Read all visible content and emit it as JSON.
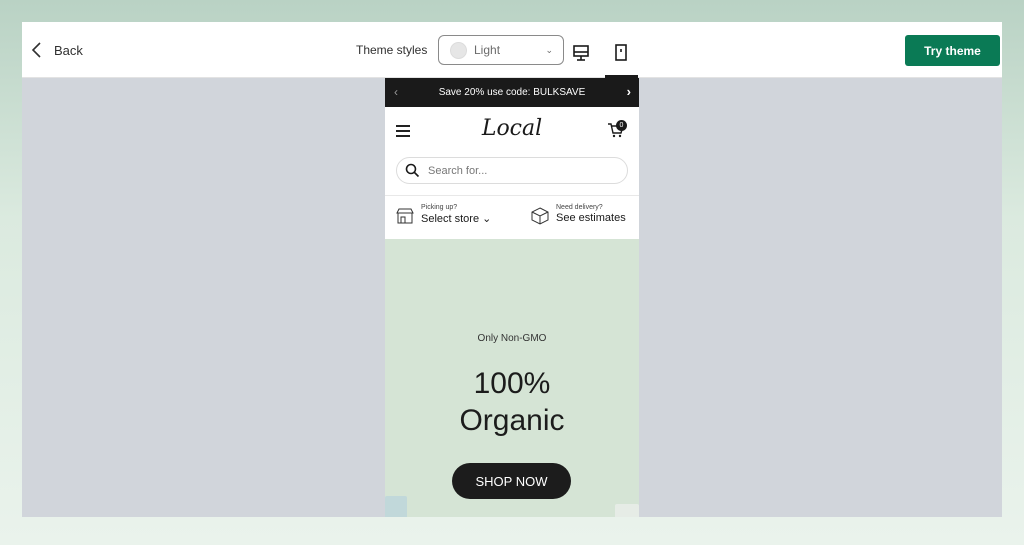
{
  "topbar": {
    "back_label": "Back",
    "theme_styles_label": "Theme styles",
    "theme_select_value": "Light",
    "try_theme_label": "Try theme",
    "accent_color": "#0a7a55"
  },
  "store": {
    "announcement": "Save 20% use code: BULKSAVE",
    "logo": "Local",
    "cart_count": "0",
    "search_placeholder": "Search for...",
    "pickup_small": "Picking up?",
    "pickup_main": "Select store",
    "delivery_small": "Need delivery?",
    "delivery_main": "See estimates"
  },
  "hero": {
    "eyebrow": "Only Non-GMO",
    "title_line1": "100%",
    "title_line2": "Organic",
    "button_label": "SHOP NOW",
    "background": "#d5e4d5"
  }
}
